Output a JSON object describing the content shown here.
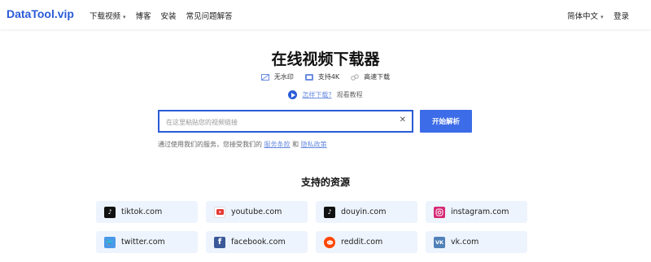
{
  "header": {
    "logo": "DataTool.vip",
    "nav": [
      "下载视频",
      "博客",
      "安装",
      "常见问题解答"
    ],
    "language": "简体中文",
    "login": "登录"
  },
  "main": {
    "title": "在线视频下载器",
    "features": [
      "无水印",
      "支持4K",
      "高速下载"
    ],
    "help_link": "怎样下载?",
    "help_video": "观看教程",
    "search": {
      "placeholder": "在这里粘贴您的视频链接",
      "value": ""
    },
    "start_button": "开始解析",
    "terms_prefix": "通过使用我们的服务，您接受我们的",
    "terms_link": "服务条款",
    "terms_and": "和",
    "privacy_link": "隐私政策"
  },
  "resources": {
    "title": "支持的资源",
    "items": [
      {
        "label": "tiktok.com",
        "icon": "tiktok-icon",
        "color": "#111111"
      },
      {
        "label": "youtube.com",
        "icon": "youtube-icon",
        "color": "#e53935"
      },
      {
        "label": "douyin.com",
        "icon": "douyin-icon",
        "color": "#111111"
      },
      {
        "label": "instagram.com",
        "icon": "instagram-icon",
        "color": "#d62976"
      },
      {
        "label": "twitter.com",
        "icon": "twitter-icon",
        "color": "#4a99e9"
      },
      {
        "label": "facebook.com",
        "icon": "facebook-icon",
        "color": "#3b5998"
      },
      {
        "label": "reddit.com",
        "icon": "reddit-icon",
        "color": "#ff4500"
      },
      {
        "label": "vk.com",
        "icon": "vk-icon",
        "color": "#5181b8"
      }
    ]
  },
  "colors": {
    "accent": "#2a5bd7",
    "button": "#3d6ce8",
    "card_bg": "#eef4fd"
  }
}
